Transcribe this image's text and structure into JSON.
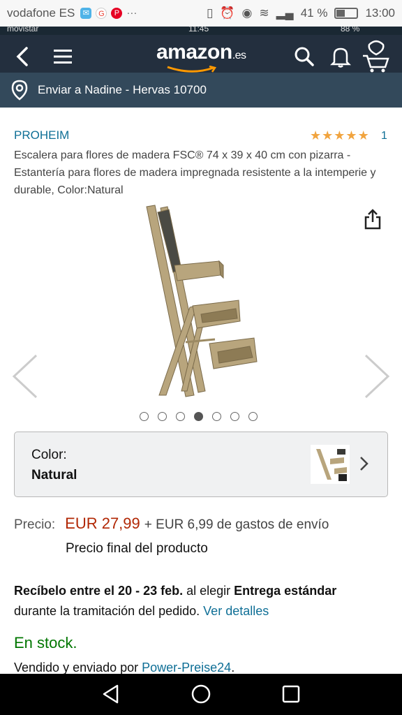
{
  "system_status": {
    "carrier": "vodafone ES",
    "notif_icons": [
      "mail-icon",
      "google-icon",
      "pinterest-icon"
    ],
    "more": "···",
    "battery_pct": "41 %",
    "time": "13:00"
  },
  "inner_status": {
    "carrier": "movistar",
    "time": "11:45",
    "battery": "88 %"
  },
  "header": {
    "logo_text": "amazon",
    "logo_suffix": ".es"
  },
  "delivery_bar": {
    "text": "Enviar a Nadine - Hervas 10700"
  },
  "product": {
    "brand": "PROHEIM",
    "rating_stars": 5,
    "rating_count": "1",
    "title": "Escalera para flores de madera FSC® 74 x 39 x 40 cm con pizarra - Estantería para flores de madera impregnada resistente a la intemperie y durable, Color:Natural",
    "image_count": 7,
    "active_image": 4
  },
  "color_selector": {
    "label": "Color:",
    "value": "Natural"
  },
  "pricing": {
    "label": "Precio:",
    "price": "EUR 27,99",
    "shipping": "+ EUR 6,99 de gastos de envío",
    "final_note": "Precio final del producto"
  },
  "delivery_info": {
    "bold_1": "Recíbelo entre el 20 - 23 feb.",
    "text_1": " al elegir ",
    "bold_2": "Entrega estándar",
    "text_2": "durante la tramitación del pedido. ",
    "link": "Ver detalles"
  },
  "stock": {
    "status": "En stock."
  },
  "seller": {
    "prefix": "Vendido y enviado por ",
    "name": "Power-Preise24",
    "suffix": "."
  },
  "colors": {
    "header_bg": "#232f3e",
    "delivery_bg": "#33495b",
    "link": "#0f6f96",
    "price": "#b12704",
    "stock": "#007600",
    "star": "#f1a43f"
  }
}
